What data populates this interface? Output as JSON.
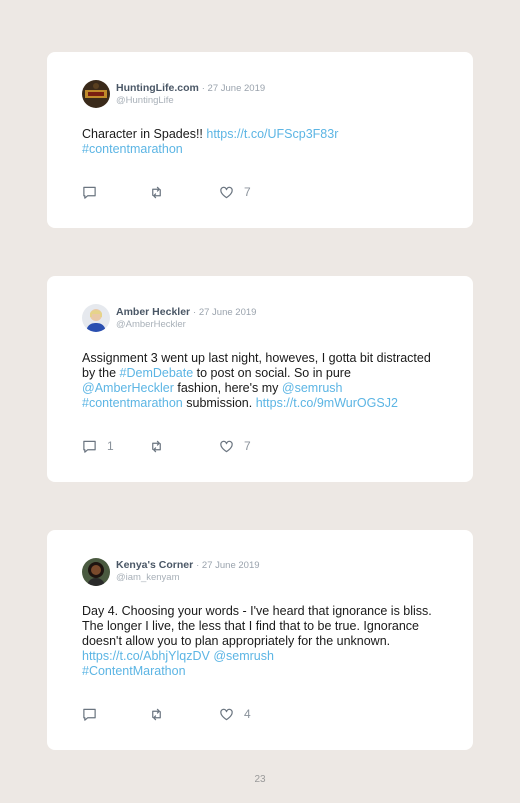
{
  "tweets": [
    {
      "name": "HuntingLife.com",
      "date": "· 27 June 2019",
      "handle": "@HuntingLife",
      "text_1": "Character in Spades!! ",
      "link_1": "https://t.co/UFScp3F83r",
      "link_2": "#contentmarathon",
      "comments": "",
      "likes": "7"
    },
    {
      "name": "Amber Heckler",
      "date": "· 27 June 2019",
      "handle": "@AmberHeckler",
      "text_1": "Assignment 3 went up last night, howeves, I gotta bit distracted by the ",
      "link_1": "#DemDebate",
      "text_2": " to post on social. So in pure ",
      "link_2": "@AmberHeckler",
      "text_3": " fashion, here's my ",
      "link_3": "@semrush",
      "link_4": "#contentmarathon",
      "text_4": " submission. ",
      "link_5": "https://t.co/9mWurOGSJ2",
      "comments": "1",
      "likes": "7"
    },
    {
      "name": "Kenya's Corner",
      "date": "· 27 June 2019",
      "handle": "@iam_kenyam",
      "text_1": "Day 4. Choosing your words - I've heard that ignorance is bliss. The longer I live, the less that I find that to be true. Ignorance doesn't allow you to plan appropriately for the unknown. ",
      "link_1": "https://t.co/AbhjYlqzDV",
      "link_2": "@semrush",
      "link_3": "#ContentMarathon",
      "comments": "",
      "likes": "4"
    }
  ],
  "page_number": "23",
  "colors": {
    "link": "#5cb5e4",
    "background": "#ede8e4",
    "card": "#ffffff"
  },
  "icons": [
    "comment-icon",
    "retweet-icon",
    "heart-icon"
  ]
}
